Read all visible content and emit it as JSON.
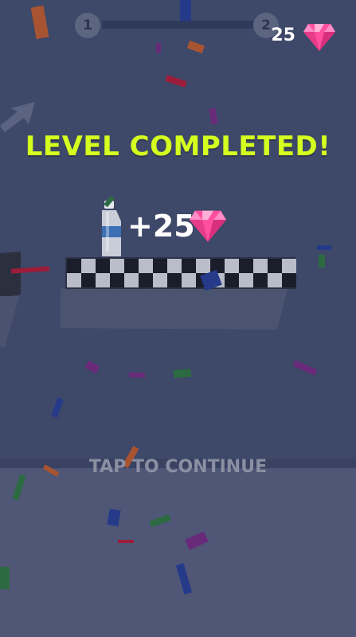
{
  "hud": {
    "level_start": "1",
    "level_end": "2",
    "progress": 0,
    "gem_count": "25",
    "gem_icon": "pink-gem-icon"
  },
  "banner": {
    "title": "LEVEL COMPLETED!",
    "reward": "+25",
    "reward_icon": "pink-gem-icon"
  },
  "prompt": {
    "continue": "TAP TO CONTINUE"
  },
  "colors": {
    "background": "#3e4868",
    "floor": "#4f5676",
    "title": "#d4ff1f",
    "gem": "#ff5aa8"
  }
}
